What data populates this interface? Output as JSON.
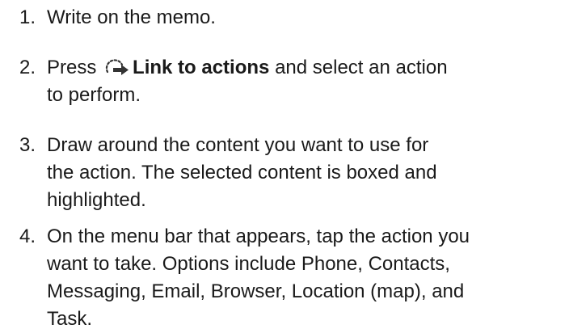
{
  "steps": [
    {
      "number": "1.",
      "lines": [
        "Write on the memo."
      ]
    },
    {
      "number": "2.",
      "prefix": "Press",
      "icon": "link-to-actions-icon",
      "bold": "Link to actions",
      "suffix": "and select an action",
      "lines": [
        "to perform."
      ]
    },
    {
      "number": "3.",
      "lines": [
        "Draw around the content you want to use for",
        "the action. The selected content is boxed and",
        "highlighted."
      ]
    },
    {
      "number": "4.",
      "lines": [
        "On the menu bar that appears, tap the action you",
        "want to take. Options include Phone, Contacts,",
        "Messaging, Email, Browser, Location (map), and",
        "Task."
      ]
    }
  ]
}
